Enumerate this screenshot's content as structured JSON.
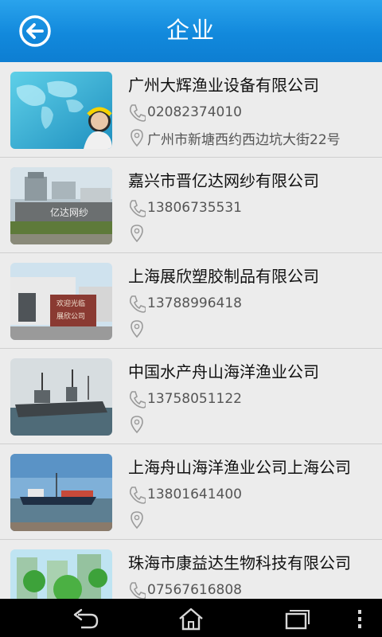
{
  "header": {
    "title": "企业"
  },
  "companies": [
    {
      "name": "广州大辉渔业设备有限公司",
      "phone": "02082374010",
      "address": "广州市新塘西约西边坑大街22号"
    },
    {
      "name": "嘉兴市晋亿达网纱有限公司",
      "phone": "13806735531",
      "address": ""
    },
    {
      "name": "上海展欣塑胶制品有限公司",
      "phone": "13788996418",
      "address": ""
    },
    {
      "name": "中国水产舟山海洋渔业公司",
      "phone": "13758051122",
      "address": ""
    },
    {
      "name": "上海舟山海洋渔业公司上海公司",
      "phone": "13801641400",
      "address": ""
    },
    {
      "name": "珠海市康益达生物科技有限公司",
      "phone": "07567616808",
      "address": ""
    }
  ],
  "thumbnails": {
    "sign_text": "亿达网纱",
    "plaque_text_1": "欢迎光临",
    "plaque_text_2": "展欣公司"
  }
}
